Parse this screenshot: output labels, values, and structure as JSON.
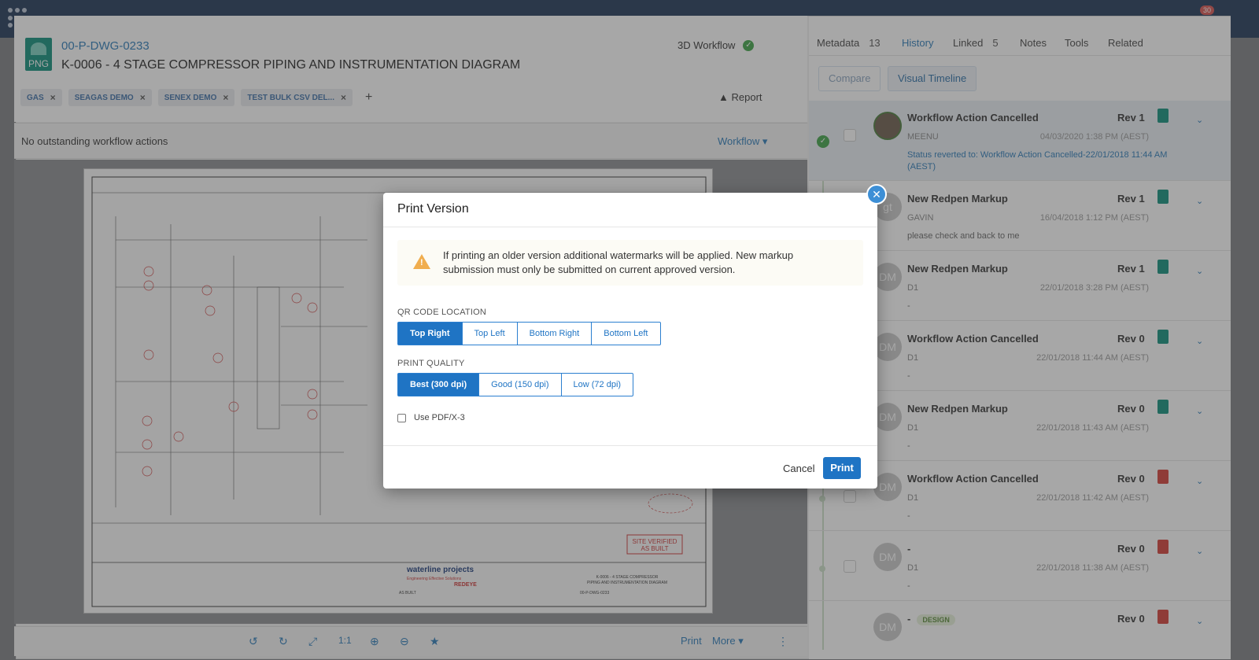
{
  "topbar": {
    "notification_count": "30"
  },
  "document": {
    "type_label": "PNG",
    "id": "00-P-DWG-0233",
    "title": "K-0006 - 4 STAGE COMPRESSOR PIPING AND INSTRUMENTATION DIAGRAM",
    "workflow_status": "3D Workflow",
    "tags": [
      "GAS",
      "SEAGAS DEMO",
      "SENEX DEMO",
      "TEST BULK CSV DEL..."
    ],
    "report_label": "Report",
    "workflow_message": "No outstanding workflow actions",
    "workflow_button": "Workflow"
  },
  "drawing": {
    "stamp_line1": "SITE VERIFIED",
    "stamp_line2": "AS BUILT",
    "company": "waterline projects",
    "company_tagline": "Engineering Effective Solutions",
    "logo_text": "REDEYE",
    "titleblock_title": "K-0006 - 4 STAGE COMPRESSOR",
    "titleblock_sub": "PIPING AND INSTRUMENTATION DIAGRAM",
    "drawing_no": "00-P-DWG-0233",
    "status_text": "AS BUILT"
  },
  "toolbar": {
    "zoom_label": "1:1",
    "print_label": "Print",
    "more_label": "More"
  },
  "tabs": [
    {
      "label": "Metadata",
      "count": "13"
    },
    {
      "label": "History",
      "count": ""
    },
    {
      "label": "Linked",
      "count": "5"
    },
    {
      "label": "Notes",
      "count": ""
    },
    {
      "label": "Tools",
      "count": ""
    },
    {
      "label": "Related",
      "count": ""
    }
  ],
  "history_buttons": {
    "compare": "Compare",
    "visual_timeline": "Visual Timeline"
  },
  "history": [
    {
      "title": "Workflow Action Cancelled",
      "rev": "Rev 1",
      "user": "MEENU",
      "date": "04/03/2020 1:38 PM (AEST)",
      "note": "Status reverted to: Workflow Action Cancelled-22/01/2018 11:44 AM (AEST)",
      "avatar": "",
      "file": "png"
    },
    {
      "title": "New Redpen Markup",
      "rev": "Rev 1",
      "user": "GAVIN",
      "date": "16/04/2018 1:12 PM (AEST)",
      "note": "please check and back to me",
      "avatar": "gt",
      "file": "png"
    },
    {
      "title": "New Redpen Markup",
      "rev": "Rev 1",
      "user": "D1",
      "date": "22/01/2018 3:28 PM (AEST)",
      "note": "-",
      "avatar": "DM",
      "file": "png"
    },
    {
      "title": "Workflow Action Cancelled",
      "rev": "Rev 0",
      "user": "D1",
      "date": "22/01/2018 11:44 AM (AEST)",
      "note": "-",
      "avatar": "DM",
      "file": "png"
    },
    {
      "title": "New Redpen Markup",
      "rev": "Rev 0",
      "user": "D1",
      "date": "22/01/2018 11:43 AM (AEST)",
      "note": "-",
      "avatar": "DM",
      "file": "png"
    },
    {
      "title": "Workflow Action Cancelled",
      "rev": "Rev 0",
      "user": "D1",
      "date": "22/01/2018 11:42 AM (AEST)",
      "note": "-",
      "avatar": "DM",
      "file": "pdf"
    },
    {
      "title": "-",
      "rev": "Rev 0",
      "user": "D1",
      "date": "22/01/2018 11:38 AM (AEST)",
      "note": "-",
      "avatar": "DM",
      "file": "pdf"
    },
    {
      "title": "-",
      "rev": "Rev 0",
      "user": "",
      "date": "",
      "note": "",
      "avatar": "DM",
      "file": "pdf",
      "badge": "DESIGN"
    }
  ],
  "modal": {
    "title": "Print Version",
    "alert": "If printing an older version additional watermarks will be applied. New markup submission must only be submitted on current approved version.",
    "qr_label": "QR CODE LOCATION",
    "qr_options": [
      "Top Right",
      "Top Left",
      "Bottom Right",
      "Bottom Left"
    ],
    "qr_selected": 0,
    "quality_label": "PRINT QUALITY",
    "quality_options": [
      "Best (300 dpi)",
      "Good (150 dpi)",
      "Low (72 dpi)"
    ],
    "quality_selected": 0,
    "pdfx_label": "Use PDF/X-3",
    "cancel": "Cancel",
    "print": "Print"
  }
}
